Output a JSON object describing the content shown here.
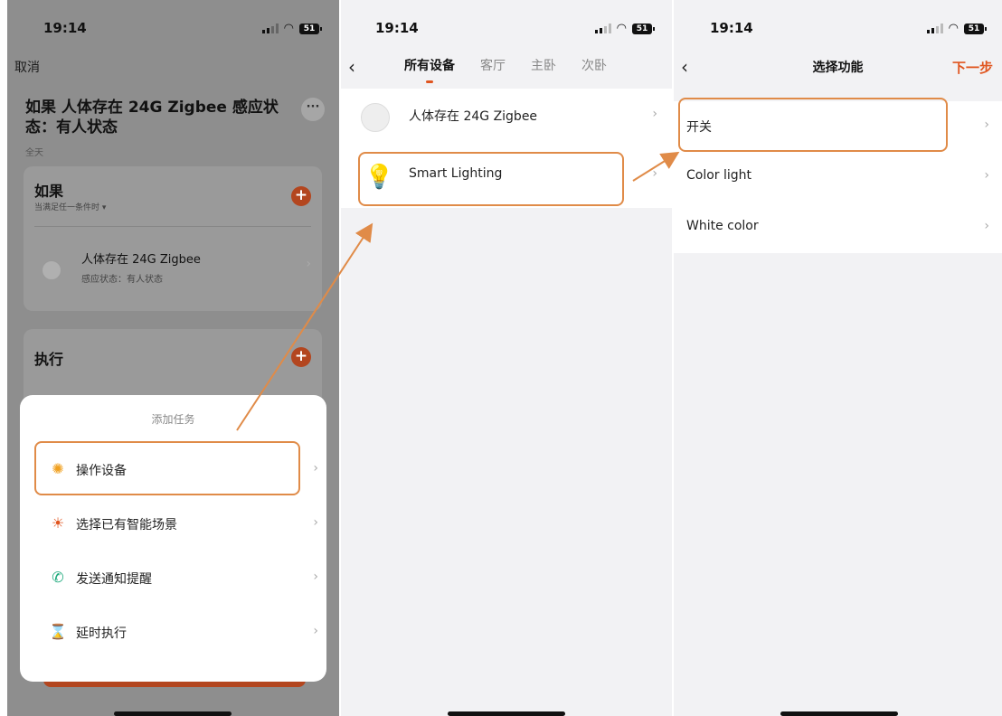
{
  "status_bar": {
    "time": "19:14",
    "battery": "51"
  },
  "screen1": {
    "cancel_label": "取消",
    "rule_title": "如果 人体存在 24G Zigbee 感应状态：有人状态",
    "more_label": "···",
    "rule_subtitle": "全天",
    "if_card": {
      "title": "如果",
      "hint": "当满足任一条件时 ▾",
      "condition_device": "人体存在 24G Zigbee",
      "condition_state": "感应状态：有人状态"
    },
    "exec_card": {
      "title": "执行"
    },
    "sheet": {
      "title": "添加任务",
      "items": [
        {
          "label": "操作设备",
          "icon": "sun-icon"
        },
        {
          "label": "选择已有智能场景",
          "icon": "sunrise-icon"
        },
        {
          "label": "发送通知提醒",
          "icon": "phone-message-icon"
        },
        {
          "label": "延时执行",
          "icon": "hourglass-icon"
        }
      ]
    }
  },
  "screen2": {
    "tabs": [
      "所有设备",
      "客厅",
      "主卧",
      "次卧"
    ],
    "devices": [
      {
        "name": "人体存在 24G Zigbee",
        "icon": "sensor-icon"
      },
      {
        "name": "Smart Lighting",
        "icon": "bulb-icon"
      }
    ]
  },
  "screen3": {
    "title": "选择功能",
    "next_label": "下一步",
    "functions": [
      "开关",
      "Color light",
      "White color"
    ]
  },
  "colors": {
    "accent": "#e0551f",
    "highlight": "#e08b48",
    "dim_bg": "#8e8e8e"
  }
}
